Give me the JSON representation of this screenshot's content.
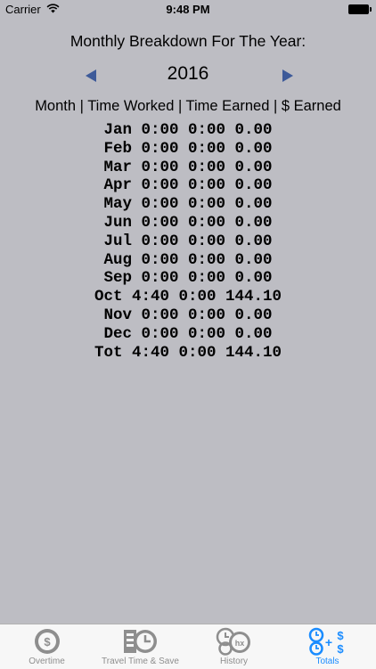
{
  "status": {
    "carrier": "Carrier",
    "time": "9:48 PM"
  },
  "heading": "Monthly Breakdown For The Year:",
  "year": "2016",
  "columns_label": "Month | Time Worked | Time Earned | $ Earned",
  "rows": [
    "Jan 0:00 0:00 0.00",
    "Feb 0:00 0:00 0.00",
    "Mar 0:00 0:00 0.00",
    "Apr 0:00 0:00 0.00",
    "May 0:00 0:00 0.00",
    "Jun 0:00 0:00 0.00",
    "Jul 0:00 0:00 0.00",
    "Aug 0:00 0:00 0.00",
    "Sep 0:00 0:00 0.00",
    "Oct 4:40 0:00 144.10",
    "Nov 0:00 0:00 0.00",
    "Dec 0:00 0:00 0.00",
    "Tot 4:40 0:00 144.10"
  ],
  "tabs": [
    {
      "label": "Overtime",
      "icon": "clock-dollar-icon",
      "active": false
    },
    {
      "label": "Travel Time & Save",
      "icon": "travel-clock-icon",
      "active": false
    },
    {
      "label": "History",
      "icon": "history-clock-icon",
      "active": false
    },
    {
      "label": "Totals",
      "icon": "totals-clock-plus-dollar-icon",
      "active": true
    }
  ],
  "colors": {
    "background": "#bdbdc3",
    "arrow": "#3d5a99",
    "tab_active": "#1a8cff",
    "tab_inactive": "#8e8e8e"
  }
}
